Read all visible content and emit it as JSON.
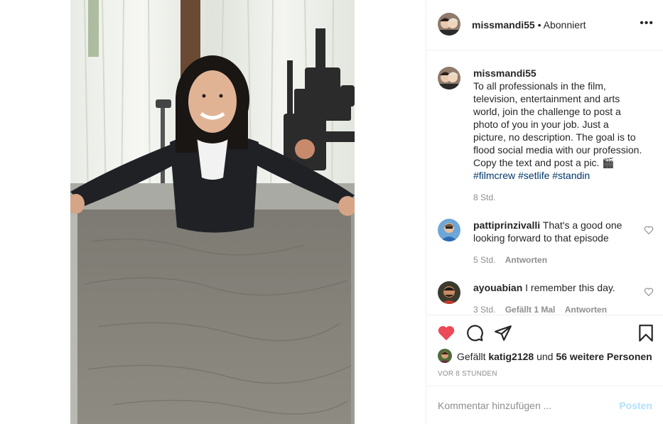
{
  "post": {
    "author": "missmandi55",
    "follow_status": "• Abonniert",
    "more_icon": "more-horizontal-icon"
  },
  "caption": {
    "username": "missmandi55",
    "lines": [
      "To all professionals in the film,",
      "television, entertainment and arts",
      "world, join the challenge to post a",
      "photo of you in your job. Just a",
      "picture, no description. The goal is to",
      "flood social media with our profession.",
      "Copy the text and post a pic. 🎬"
    ],
    "hashtags": "#filmcrew #setlife #standin",
    "time": "8 Std."
  },
  "comments": [
    {
      "username": "pattiprinzivalli",
      "text": "That's a good one looking forward to that episode",
      "time": "5 Std.",
      "reply": "Antworten"
    },
    {
      "username": "ayouabian",
      "text": "I remember this day.",
      "time": "3 Std.",
      "likes": "Gefällt 1 Mal",
      "reply": "Antworten"
    }
  ],
  "actions": {
    "like_icon": "heart-filled-icon",
    "comment_icon": "comment-icon",
    "share_icon": "share-icon",
    "save_icon": "bookmark-icon",
    "like_color": "#ed4956"
  },
  "likes": {
    "prefix": "Gefällt",
    "user": "katig2128",
    "conj": "und",
    "others": "56 weitere Personen"
  },
  "timestamp": "VOR 8 STUNDEN",
  "comment_input": {
    "placeholder": "Kommentar hinzufügen ...",
    "post_label": "Posten"
  }
}
